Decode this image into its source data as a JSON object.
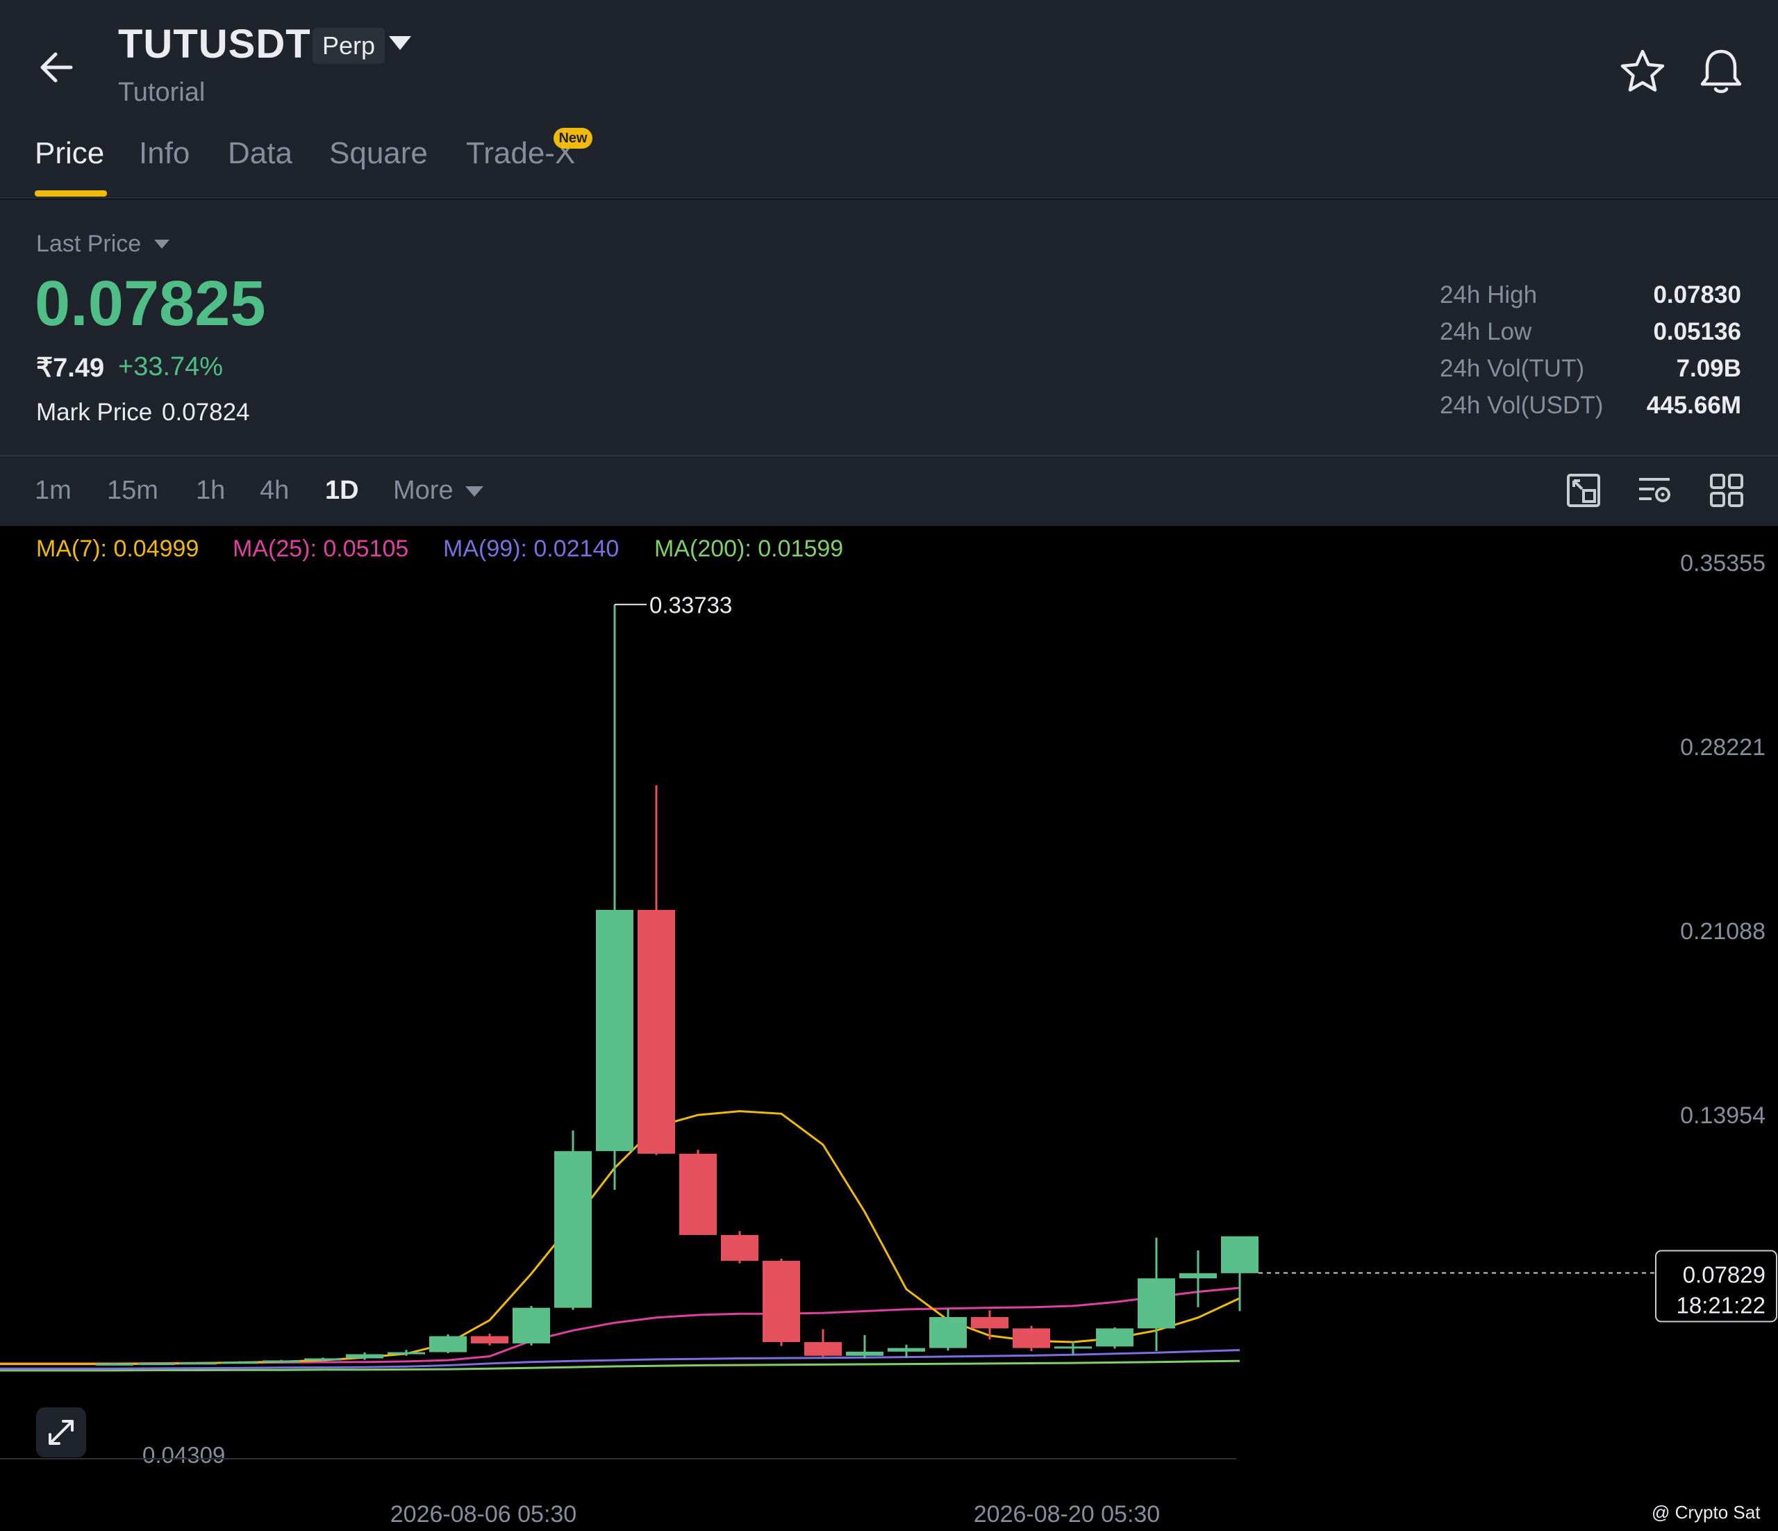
{
  "header": {
    "symbol": "TUTUSDT",
    "contract_type": "Perp",
    "subtitle": "Tutorial",
    "tabs": [
      {
        "label": "Price",
        "active": true
      },
      {
        "label": "Info"
      },
      {
        "label": "Data"
      },
      {
        "label": "Square"
      },
      {
        "label": "Trade-X",
        "badge": "New"
      }
    ]
  },
  "price": {
    "label": "Last Price",
    "last": "0.07825",
    "inr": "₹7.49",
    "change": "+33.74%",
    "mark_label": "Mark Price",
    "mark_value": "0.07824"
  },
  "stats": [
    {
      "label": "24h High",
      "value": "0.07830"
    },
    {
      "label": "24h Low",
      "value": "0.05136"
    },
    {
      "label": "24h Vol(TUT)",
      "value": "7.09B"
    },
    {
      "label": "24h Vol(USDT)",
      "value": "445.66M"
    }
  ],
  "timeframes": [
    "1m",
    "15m",
    "1h",
    "4h",
    "1D",
    "More"
  ],
  "active_timeframe": "1D",
  "ma": [
    {
      "label": "MA(7): 0.04999",
      "color": "#f0b90b"
    },
    {
      "label": "MA(25): 0.05105",
      "color": "#e040a0"
    },
    {
      "label": "MA(99): 0.02140",
      "color": "#7b6fe0"
    },
    {
      "label": "MA(200): 0.01599",
      "color": "#7fcf6a"
    }
  ],
  "colors": {
    "up": "#5bbf8a",
    "down": "#e5525d",
    "accent": "#f0b90b",
    "bg": "#1f232b"
  },
  "chart_data": {
    "type": "candlestick",
    "y_ticks": [
      "0.35355",
      "0.28221",
      "0.21088",
      "0.13954"
    ],
    "x_ticks": [
      "2026-08-06 05:30",
      "2026-08-20 05:30"
    ],
    "high_label": "0.33733",
    "low_label": "0.04309",
    "current_price": "0.07829",
    "countdown": "18:21:22",
    "candles": [
      {
        "o": 0.043,
        "h": 0.0434,
        "l": 0.0428,
        "c": 0.0432
      },
      {
        "o": 0.0432,
        "h": 0.0436,
        "l": 0.0429,
        "c": 0.0434
      },
      {
        "o": 0.0434,
        "h": 0.0438,
        "l": 0.0431,
        "c": 0.0436
      },
      {
        "o": 0.0436,
        "h": 0.0441,
        "l": 0.0433,
        "c": 0.0439
      },
      {
        "o": 0.0439,
        "h": 0.0446,
        "l": 0.0436,
        "c": 0.0444
      },
      {
        "o": 0.0444,
        "h": 0.0455,
        "l": 0.0441,
        "c": 0.0452
      },
      {
        "o": 0.0452,
        "h": 0.0475,
        "l": 0.0446,
        "c": 0.0468
      },
      {
        "o": 0.0468,
        "h": 0.0485,
        "l": 0.0462,
        "c": 0.0476
      },
      {
        "o": 0.0476,
        "h": 0.0545,
        "l": 0.0472,
        "c": 0.0538
      },
      {
        "o": 0.0538,
        "h": 0.0548,
        "l": 0.0502,
        "c": 0.051
      },
      {
        "o": 0.051,
        "h": 0.0655,
        "l": 0.0502,
        "c": 0.0648
      },
      {
        "o": 0.0648,
        "h": 0.1335,
        "l": 0.064,
        "c": 0.1255
      },
      {
        "o": 0.1255,
        "h": 0.33733,
        "l": 0.1105,
        "c": 0.219
      },
      {
        "o": 0.219,
        "h": 0.2673,
        "l": 0.124,
        "c": 0.1245
      },
      {
        "o": 0.1245,
        "h": 0.126,
        "l": 0.093,
        "c": 0.093
      },
      {
        "o": 0.093,
        "h": 0.0945,
        "l": 0.082,
        "c": 0.083
      },
      {
        "o": 0.083,
        "h": 0.0838,
        "l": 0.05,
        "c": 0.0515
      },
      {
        "o": 0.0515,
        "h": 0.0565,
        "l": 0.0458,
        "c": 0.0462
      },
      {
        "o": 0.0462,
        "h": 0.0542,
        "l": 0.0452,
        "c": 0.0478
      },
      {
        "o": 0.0478,
        "h": 0.0505,
        "l": 0.0455,
        "c": 0.0492
      },
      {
        "o": 0.0492,
        "h": 0.0645,
        "l": 0.0482,
        "c": 0.0612
      },
      {
        "o": 0.0612,
        "h": 0.0638,
        "l": 0.0525,
        "c": 0.0568
      },
      {
        "o": 0.0568,
        "h": 0.0578,
        "l": 0.048,
        "c": 0.0492
      },
      {
        "o": 0.0492,
        "h": 0.0518,
        "l": 0.0468,
        "c": 0.0498
      },
      {
        "o": 0.0498,
        "h": 0.0572,
        "l": 0.049,
        "c": 0.0568
      },
      {
        "o": 0.0568,
        "h": 0.092,
        "l": 0.048,
        "c": 0.0762
      },
      {
        "o": 0.0762,
        "h": 0.087,
        "l": 0.065,
        "c": 0.0782
      },
      {
        "o": 0.0782,
        "h": 0.0784,
        "l": 0.0635,
        "c": 0.0925
      }
    ],
    "ma7": [
      0.043,
      0.0431,
      0.0433,
      0.0436,
      0.0439,
      0.0445,
      0.0455,
      0.047,
      0.051,
      0.06,
      0.078,
      0.098,
      0.119,
      0.135,
      0.1395,
      0.141,
      0.14,
      0.128,
      0.102,
      0.072,
      0.06,
      0.054,
      0.052,
      0.0515,
      0.053,
      0.056,
      0.061,
      0.0685
    ],
    "ma25": [
      0.0432,
      0.0433,
      0.0434,
      0.0435,
      0.0436,
      0.0437,
      0.0438,
      0.044,
      0.0445,
      0.046,
      0.052,
      0.056,
      0.059,
      0.061,
      0.062,
      0.0625,
      0.0625,
      0.0628,
      0.0635,
      0.0642,
      0.0645,
      0.0648,
      0.065,
      0.0655,
      0.067,
      0.069,
      0.071,
      0.0725
    ],
    "ma99": [
      0.0412,
      0.0413,
      0.0414,
      0.0415,
      0.0416,
      0.0417,
      0.0418,
      0.042,
      0.0425,
      0.0432,
      0.0438,
      0.0442,
      0.0445,
      0.0448,
      0.045,
      0.0452,
      0.0453,
      0.0454,
      0.0455,
      0.0457,
      0.0459,
      0.0461,
      0.0463,
      0.0466,
      0.047,
      0.0474,
      0.0479,
      0.0484
    ],
    "ma200": [
      0.0405,
      0.0406,
      0.0406,
      0.0407,
      0.0407,
      0.0408,
      0.0408,
      0.0409,
      0.041,
      0.0412,
      0.0415,
      0.0418,
      0.0421,
      0.0423,
      0.0425,
      0.0426,
      0.0427,
      0.0428,
      0.0429,
      0.043,
      0.0431,
      0.0432,
      0.0433,
      0.0434,
      0.0436,
      0.0438,
      0.044,
      0.0442
    ]
  },
  "watermark": "@ Crypto Sat"
}
